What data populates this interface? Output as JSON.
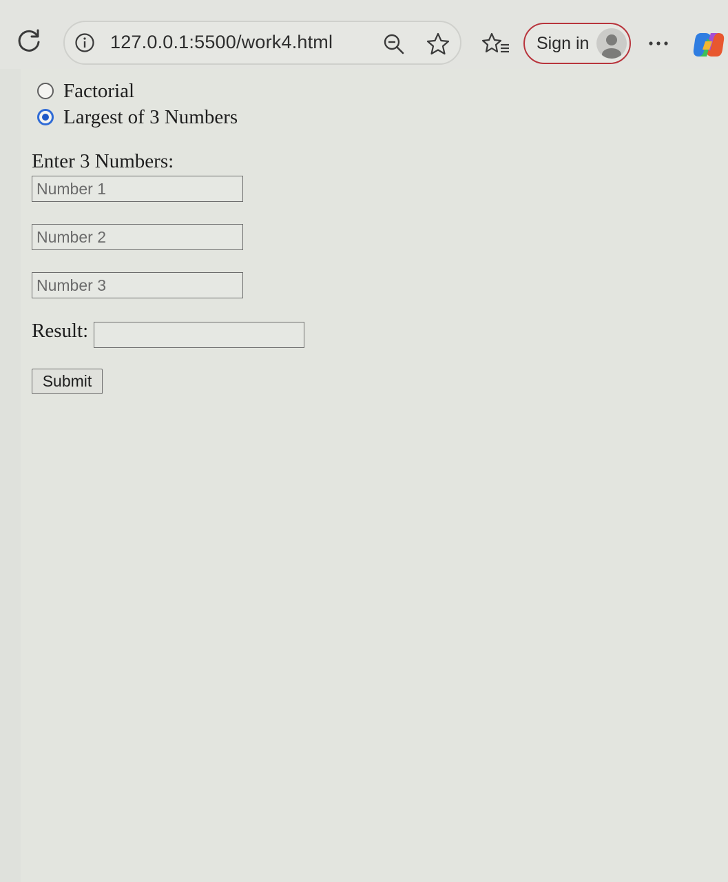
{
  "browser": {
    "url": "127.0.0.1:5500/work4.html",
    "sign_in_label": "Sign in",
    "accent_color": "#b8343c",
    "icons": [
      "reload-icon",
      "info-icon",
      "zoom-out-icon",
      "star-icon",
      "favorites-icon",
      "avatar",
      "more-icon",
      "copilot-icon"
    ]
  },
  "form": {
    "options": [
      {
        "label": "Factorial",
        "checked": false
      },
      {
        "label": "Largest of 3 Numbers",
        "checked": true
      }
    ],
    "section_label": "Enter 3 Numbers:",
    "inputs": [
      {
        "placeholder": "Number 1",
        "value": ""
      },
      {
        "placeholder": "Number 2",
        "value": ""
      },
      {
        "placeholder": "Number 3",
        "value": ""
      }
    ],
    "result_label": "Result:",
    "result_value": "",
    "submit_label": "Submit",
    "radio_color": "#1f59c7"
  }
}
